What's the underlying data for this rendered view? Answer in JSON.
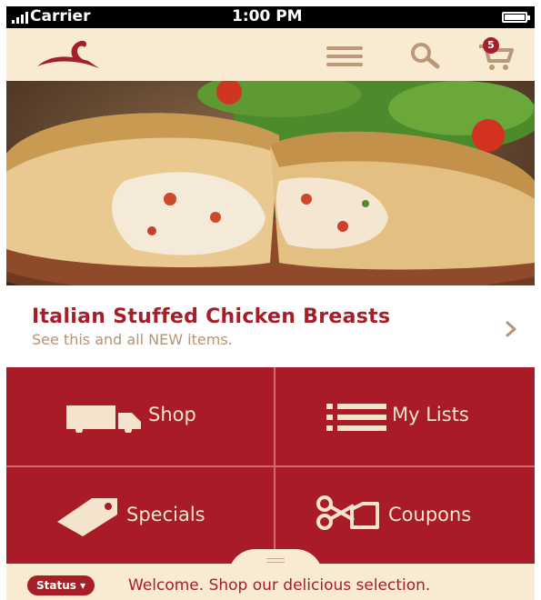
{
  "status_bar": {
    "carrier": "Carrier",
    "time": "1:00 PM"
  },
  "header": {
    "logo_icon": "swan-logo-icon",
    "menu_icon": "hamburger-menu-icon",
    "search_icon": "search-icon",
    "cart_icon": "cart-icon",
    "cart_count": "5"
  },
  "hero": {
    "image": "stuffed-chicken-breasts-photo"
  },
  "promo": {
    "title": "Italian Stuffed Chicken Breasts",
    "subtitle": "See this and all NEW items.",
    "chevron_icon": "chevron-right-icon"
  },
  "tiles": [
    {
      "label": "Shop",
      "icon": "truck-icon"
    },
    {
      "label": "My Lists",
      "icon": "list-icon"
    },
    {
      "label": "Specials",
      "icon": "tag-icon"
    },
    {
      "label": "Coupons",
      "icon": "scissors-coupon-icon"
    }
  ],
  "footer": {
    "status_label": "Status",
    "status_caret": "▾",
    "welcome": "Welcome. Shop our delicious selection."
  },
  "colors": {
    "brand_red": "#a61e28",
    "cream": "#f9ead2",
    "tan": "#b49478"
  }
}
